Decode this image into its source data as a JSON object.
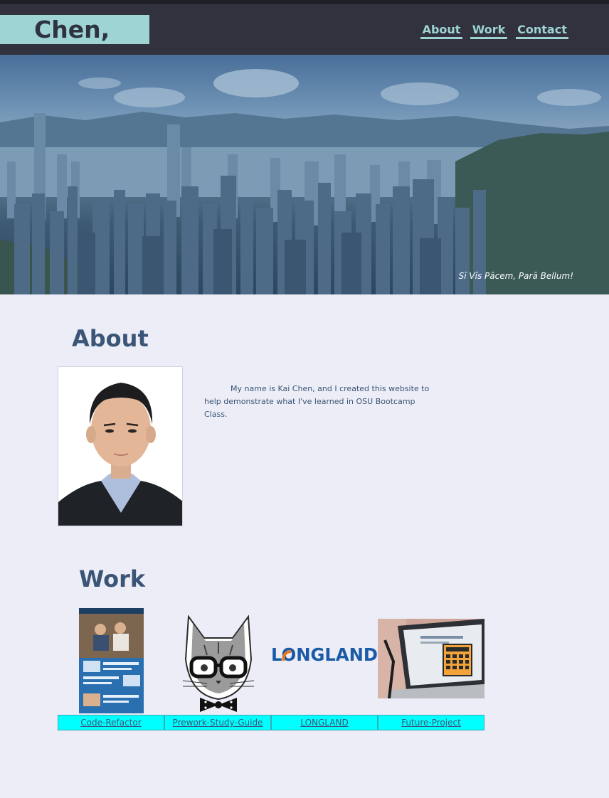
{
  "header": {
    "brand": "Chen, Kai",
    "nav": [
      "About",
      "Work",
      "Contact"
    ]
  },
  "hero": {
    "motto": "Sī Vīs Pācem, Parā Bellum!"
  },
  "about": {
    "heading": "About",
    "text": "My name is Kai Chen, and I created this website to help demonstrate what I've learned in OSU Bootcamp Class."
  },
  "work": {
    "heading": "Work",
    "projects": [
      {
        "label": "Code-Refactor"
      },
      {
        "label": "Prework-Study-Guide"
      },
      {
        "label": "LONGLAND",
        "logo_text": "LONGLAND"
      },
      {
        "label": "Future-Project"
      }
    ]
  },
  "colors": {
    "header_bg": "#31323d",
    "accent": "#9fd4d4",
    "heading": "#3b5577",
    "page_bg": "#ecedf6",
    "work_link_bg": "#00ffff"
  }
}
